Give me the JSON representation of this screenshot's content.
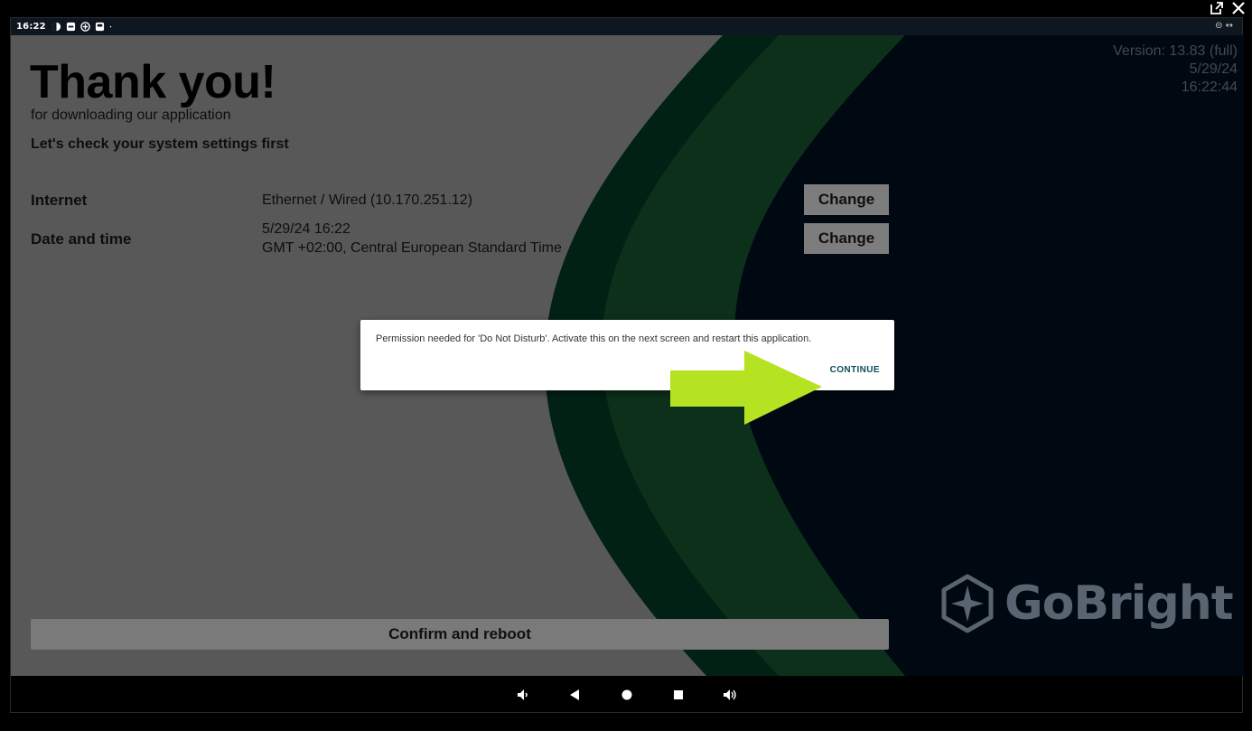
{
  "statusbar": {
    "time": "16:22",
    "icons": [
      "brightness-icon",
      "screen-icon",
      "plus-circle-icon",
      "cast-icon",
      "dot-icon"
    ],
    "right_icons": "⊝ ↔"
  },
  "app": {
    "title": "Thank you!",
    "subtitle": "for downloading our application",
    "lead": "Let's check your system settings first",
    "settings": [
      {
        "label": "Internet",
        "value_line1": "Ethernet / Wired (10.170.251.12)",
        "value_line2": "",
        "button": "Change"
      },
      {
        "label": "Date and time",
        "value_line1": "5/29/24 16:22",
        "value_line2": "GMT +02:00, Central European Standard Time",
        "button": "Change"
      }
    ],
    "confirm_button": "Confirm and reboot",
    "version": {
      "line1": "Version: 13.83 (full)",
      "line2": "5/29/24",
      "line3": "16:22:44"
    },
    "logo_text": "GoBright"
  },
  "dialog": {
    "message": "Permission needed for 'Do Not Disturb'. Activate this on the next screen and restart this application.",
    "button": "CONTINUE"
  },
  "colors": {
    "navy": "#011328",
    "green_dark": "#014a2d",
    "green_light": "#1d6b3b",
    "light_gray": "#c4c4c4",
    "arrow": "#b5e322"
  }
}
